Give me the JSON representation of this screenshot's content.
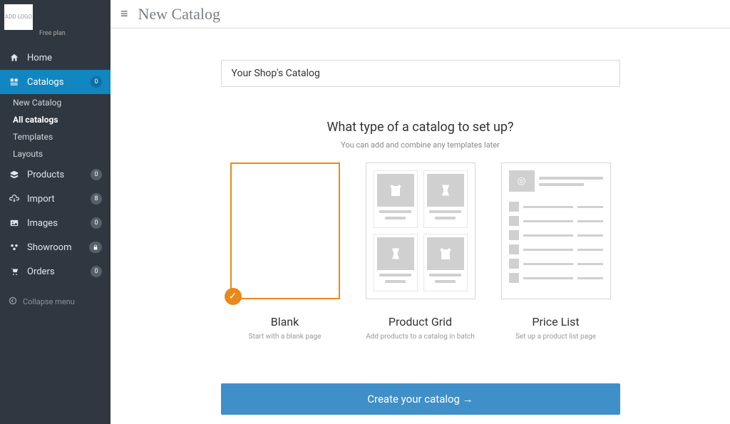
{
  "header": {
    "title": "New Catalog"
  },
  "sidebar": {
    "logo_placeholder": "ADD LOGO",
    "store_name": "",
    "plan": "Free plan",
    "items": [
      {
        "icon": "home",
        "label": "Home",
        "badge": null
      },
      {
        "icon": "catalogs",
        "label": "Catalogs",
        "badge": "0",
        "sub": [
          {
            "label": "New Catalog"
          },
          {
            "label": "All catalogs",
            "selected": true
          },
          {
            "label": "Templates"
          },
          {
            "label": "Layouts"
          }
        ]
      },
      {
        "icon": "products",
        "label": "Products",
        "badge": "0"
      },
      {
        "icon": "import",
        "label": "Import",
        "badge": "8"
      },
      {
        "icon": "images",
        "label": "Images",
        "badge": "0"
      },
      {
        "icon": "showroom",
        "label": "Showroom",
        "badge_icon": "lock"
      },
      {
        "icon": "orders",
        "label": "Orders",
        "badge": "0"
      }
    ],
    "collapse_label": "Collapse menu"
  },
  "form": {
    "catalog_name": "Your Shop's Catalog",
    "question": "What type of a catalog to set up?",
    "sub_question": "You can add and combine any templates later",
    "templates": [
      {
        "title": "Blank",
        "desc": "Start with a blank page",
        "selected": true
      },
      {
        "title": "Product Grid",
        "desc": "Add products to a catalog in batch"
      },
      {
        "title": "Price List",
        "desc": "Set up a product list page"
      }
    ],
    "create_button": "Create your catalog →"
  }
}
